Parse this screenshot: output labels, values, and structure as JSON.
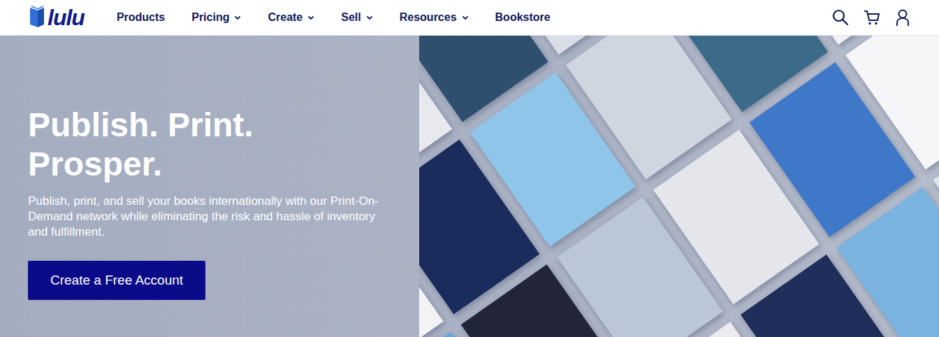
{
  "logo": {
    "text": "lulu"
  },
  "nav": {
    "items": [
      {
        "label": "Products",
        "dropdown": false
      },
      {
        "label": "Pricing",
        "dropdown": true
      },
      {
        "label": "Create",
        "dropdown": true
      },
      {
        "label": "Sell",
        "dropdown": true
      },
      {
        "label": "Resources",
        "dropdown": true
      },
      {
        "label": "Bookstore",
        "dropdown": false
      }
    ]
  },
  "hero": {
    "headline": [
      "Publish. Print.",
      "Prosper."
    ],
    "body": "Publish, print, and sell your books internationally with our Print-On-Demand network while eliminating the risk and hassle of inventory and fulfillment.",
    "button": "Create a Free Account"
  }
}
